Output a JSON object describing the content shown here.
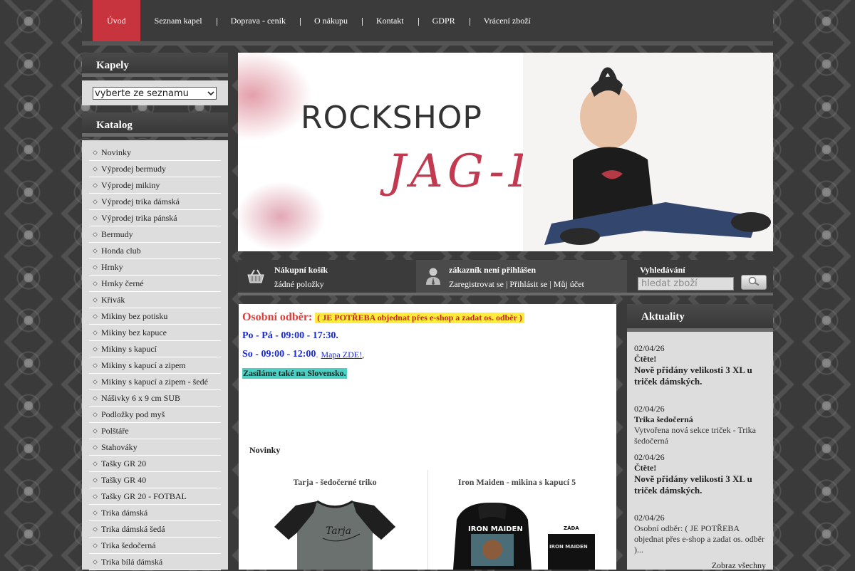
{
  "nav": {
    "items": [
      "Úvod",
      "Seznam kapel",
      "Doprava - ceník",
      "O nákupu",
      "Kontakt",
      "GDPR",
      "Vrácení zboží"
    ],
    "active": "Úvod",
    "active_color": "#c7343e"
  },
  "sidebar": {
    "kapely_title": "Kapely",
    "kapely_select": "vyberte ze seznamu",
    "katalog_title": "Katalog",
    "categories": [
      "Novinky",
      "Výprodej bermudy",
      "Výprodej mikiny",
      "Výprodej trika dámská",
      "Výprodej trika pánská",
      "Bermudy",
      "Honda club",
      "Hrnky",
      "Hrnky černé",
      "Křivák",
      "Mikiny bez potisku",
      "Mikiny bez kapuce",
      "Mikiny s kapucí",
      "Mikiny s kapucí a zipem",
      "Mikiny s kapucí a zipem - šedé",
      "Nášivky 6 x 9 cm SUB",
      "Podložky pod myš",
      "Polštáře",
      "Stahováky",
      "Tašky GR 20",
      "Tašky GR 40",
      "Tašky GR 20 - FOTBAL",
      "Trika dámská",
      "Trika dámská šedá",
      "Trika šedočerná",
      "Trika bílá dámská"
    ]
  },
  "banner": {
    "logo_top": "ROCKSHOP",
    "logo_bottom": "JAG-I"
  },
  "infobar": {
    "cart_title": "Nákupní košík",
    "cart_status": "žádné položky",
    "user_title": "zákazník není přihlášen",
    "user_links": [
      "Zaregistrovat se",
      "Přihlásit se",
      "Můj účet"
    ],
    "search_title": "Vyhledávání",
    "search_placeholder": "hledat zboží",
    "cart_icon": "basket-icon",
    "user_icon": "user-icon",
    "search_icon": "magnifier-icon"
  },
  "main": {
    "pickup_label": "Osobní odběr:",
    "pickup_note": "( JE POTŘEBA objednat přes e-shop a zadat os. odběr )",
    "hours_weekday": "Po - Pá - 09:00 - 17:30.",
    "hours_saturday": "So - 09:00 - 12:00",
    "map_link": "Mapa ZDE!",
    "slovakia": "Zasíláme také na Slovensko.",
    "novinky_label": "Novinky",
    "products": [
      {
        "title": "Tarja - šedočerné triko"
      },
      {
        "title": "Iron Maiden - mikina s kapucí 5"
      }
    ],
    "product_print_text": [
      "Tarja",
      "IRON MAIDEN",
      "ZÁDA",
      "IRON MAIDEN"
    ]
  },
  "news": {
    "title": "Aktuality",
    "items": [
      {
        "date": "02/04/26",
        "head": "Čtěte!",
        "body": "Nově přidány velikosti 3 XL u triček dámských."
      },
      {
        "date": "02/04/26",
        "head": "Trika šedočerná",
        "body": "Vytvořena nová sekce triček - Trika šedočerná"
      },
      {
        "date": "02/04/26",
        "head": "Čtěte!",
        "body": "Nově přidány velikosti 3 XL u triček dámských."
      },
      {
        "date": "02/04/26",
        "head": "",
        "body": "Osobní odběr:  ( JE POTŘEBA objednat přes e-shop a zadat os. odběr )..."
      }
    ],
    "more": "Zobraz všechny"
  }
}
